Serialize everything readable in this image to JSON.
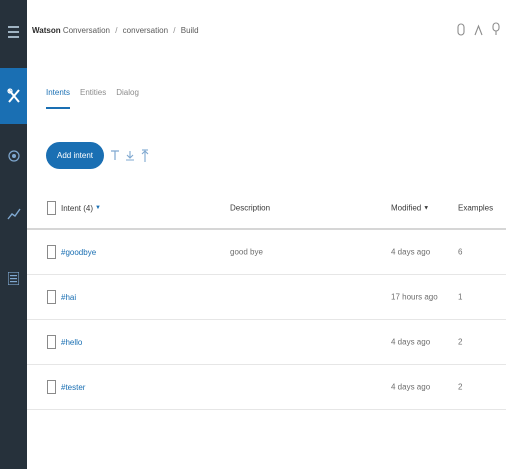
{
  "header": {
    "brand": "Watson",
    "crumbs": [
      "Conversation",
      "conversation",
      "Build"
    ],
    "separator": "/"
  },
  "rail": {
    "icons": [
      "menu-icon",
      "tools-icon",
      "target-icon",
      "chart-icon",
      "list-icon"
    ],
    "active": "tools-icon"
  },
  "tabs": [
    {
      "label": "Intents",
      "active": true
    },
    {
      "label": "Entities",
      "active": false
    },
    {
      "label": "Dialog",
      "active": false
    }
  ],
  "toolbar": {
    "add_label": "Add intent",
    "icons": [
      "filter-icon",
      "download-icon",
      "upload-icon"
    ]
  },
  "table": {
    "headers": {
      "name": "Intent (4)",
      "name_sort": "▼",
      "description": "Description",
      "modified": "Modified",
      "modified_sort": "▼",
      "examples": "Examples"
    },
    "rows": [
      {
        "name": "#goodbye",
        "description": "good bye",
        "modified": "4 days ago",
        "examples": "6"
      },
      {
        "name": "#hai",
        "description": "",
        "modified": "17 hours ago",
        "examples": "1"
      },
      {
        "name": "#hello",
        "description": "",
        "modified": "4 days ago",
        "examples": "2"
      },
      {
        "name": "#tester",
        "description": "",
        "modified": "4 days ago",
        "examples": "2"
      }
    ]
  },
  "colors": {
    "accent": "#1a6fb3",
    "rail_bg": "#26313b",
    "text": "#3d3d3d"
  }
}
